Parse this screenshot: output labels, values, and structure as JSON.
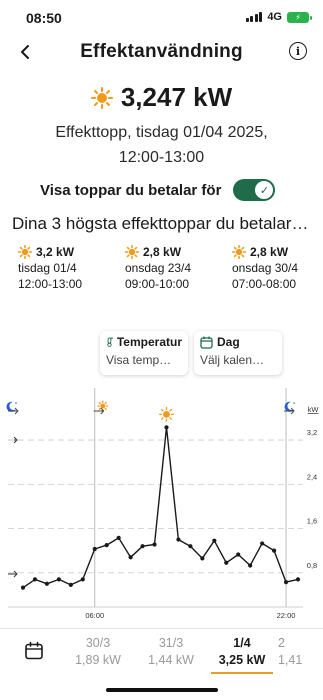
{
  "status": {
    "time": "08:50",
    "network": "4G"
  },
  "nav": {
    "title": "Effektanvändning"
  },
  "peak": {
    "value": "3,247 kW",
    "line1": "Effekttopp, tisdag 01/04 2025,",
    "line2": "12:00-13:00"
  },
  "toggle": {
    "label": "Visa toppar du betalar för",
    "on": true
  },
  "top3": {
    "heading": "Dina 3 högsta effekttoppar du betalar…",
    "items": [
      {
        "kw": "3,2 kW",
        "day": "tisdag 01/4",
        "time": "12:00-13:00"
      },
      {
        "kw": "2,8 kW",
        "day": "onsdag 23/4",
        "time": "09:00-10:00"
      },
      {
        "kw": "2,8 kW",
        "day": "onsdag 30/4",
        "time": "07:00-08:00"
      }
    ]
  },
  "filters": {
    "temperature": {
      "title": "Temperatur",
      "value": "Visa temp…"
    },
    "day": {
      "title": "Dag",
      "value": "Välj kalen…"
    }
  },
  "chart_data": {
    "type": "line",
    "unit": "kW",
    "yticks": [
      "3,2",
      "2,4",
      "1,6",
      "0,8"
    ],
    "ytick_values": [
      3.2,
      2.4,
      1.6,
      0.8
    ],
    "ylim": [
      0,
      3.6
    ],
    "xticks": [
      "06:00",
      "22:00"
    ],
    "hours": [
      0,
      1,
      2,
      3,
      4,
      5,
      6,
      7,
      8,
      9,
      10,
      11,
      12,
      13,
      14,
      15,
      16,
      17,
      18,
      19,
      20,
      21,
      22,
      23
    ],
    "values": [
      0.35,
      0.5,
      0.42,
      0.5,
      0.4,
      0.5,
      1.05,
      1.12,
      1.25,
      0.9,
      1.1,
      1.13,
      3.25,
      1.22,
      1.1,
      0.88,
      1.2,
      0.8,
      0.95,
      0.75,
      1.15,
      1.02,
      0.45,
      0.5
    ],
    "peak_marker_hour": 12,
    "sunrise_hour": 6,
    "sunset_hour": 22,
    "grid": true
  },
  "days": [
    {
      "date": "30/3",
      "kw": "1,89 kW",
      "active": false
    },
    {
      "date": "31/3",
      "kw": "1,44 kW",
      "active": false
    },
    {
      "date": "1/4",
      "kw": "3,25 kW",
      "active": true
    },
    {
      "date": "2",
      "kw": "1,41",
      "active": false
    }
  ],
  "colors": {
    "accent": "#e79d29",
    "toggle": "#1f6b4a",
    "sun": "#f09a1a",
    "moon": "#2a5bd7",
    "thermo": "#1f6b4a"
  }
}
